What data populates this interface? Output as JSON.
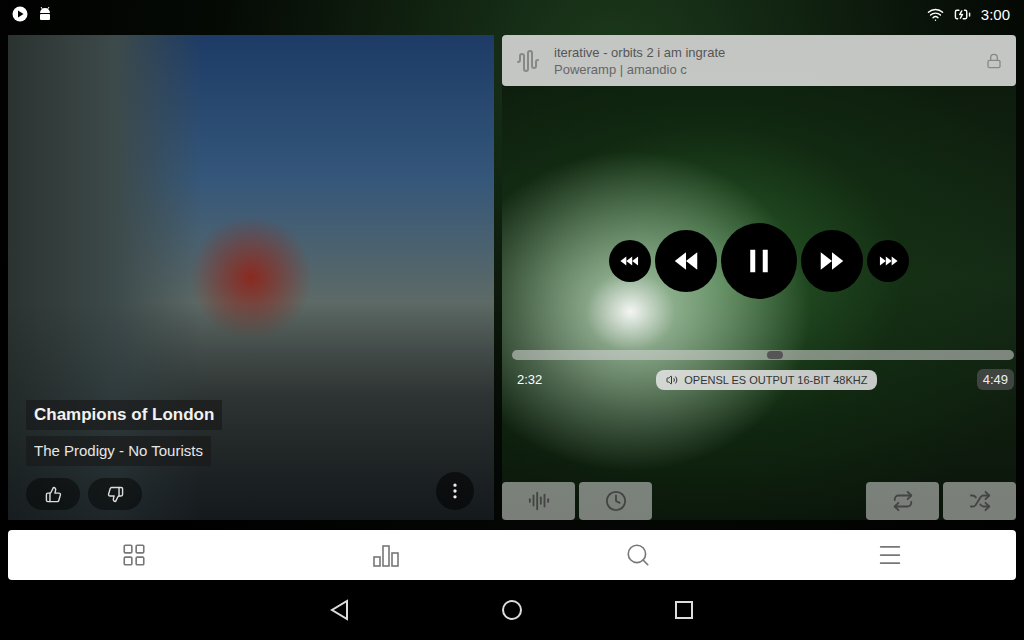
{
  "status_bar": {
    "time": "3:00"
  },
  "now_playing": {
    "title": "Champions of London",
    "artist_album": "The Prodigy - No Tourists",
    "playing": true
  },
  "rating": {
    "liked": false,
    "disliked": false
  },
  "next_track": {
    "title": "iterative - orbits 2 i am ingrate",
    "subtitle": "Poweramp | amandio c",
    "locked": true
  },
  "seek": {
    "elapsed": "2:32",
    "duration": "4:49",
    "level": 0.524
  },
  "output_badge": "OPENSL ES OUTPUT 16-BIT 48KHZ",
  "toggles": [
    {
      "kind": "repeat",
      "on": false
    },
    {
      "kind": "shuffle",
      "on": false
    }
  ]
}
